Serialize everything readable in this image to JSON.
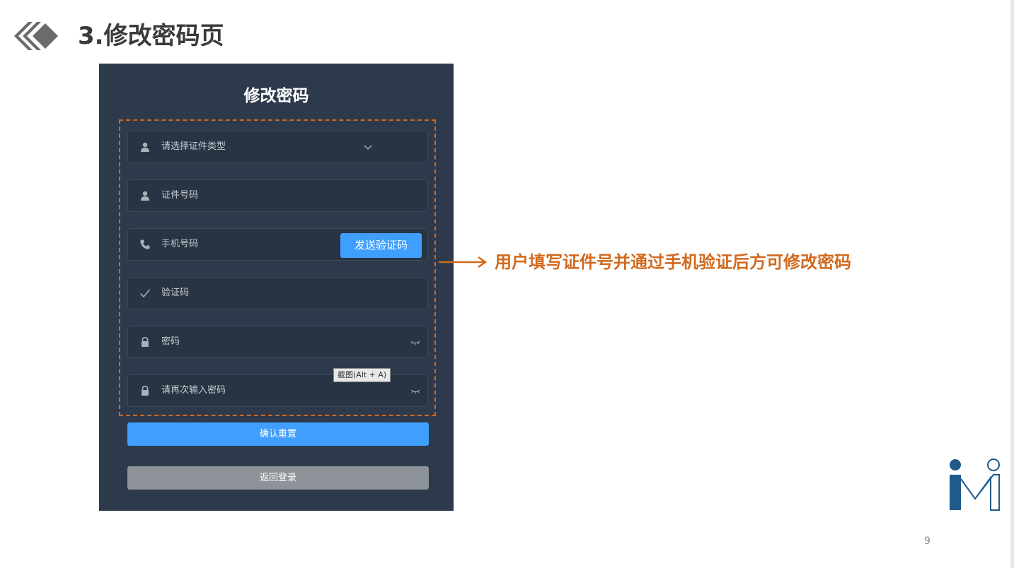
{
  "slide": {
    "title": "3.修改密码页",
    "page_number": "9",
    "annotation": "用户填写证件号并通过手机验证后方可修改密码",
    "accent_color": "#d2691e"
  },
  "form": {
    "title": "修改密码",
    "id_type": {
      "placeholder": "请选择证件类型",
      "icon": "user-icon"
    },
    "id_number": {
      "placeholder": "证件号码",
      "icon": "user-icon"
    },
    "phone": {
      "placeholder": "手机号码",
      "icon": "phone-icon",
      "send_code_label": "发送验证码"
    },
    "code": {
      "placeholder": "验证码",
      "icon": "check-icon"
    },
    "password": {
      "placeholder": "密码",
      "icon": "lock-icon"
    },
    "password_confirm": {
      "placeholder": "请再次输入密码",
      "icon": "lock-icon"
    },
    "confirm_label": "确认重置",
    "back_label": "返回登录",
    "primary_color": "#409eff"
  },
  "overlay": {
    "tooltip": "截图(Alt + A)"
  }
}
